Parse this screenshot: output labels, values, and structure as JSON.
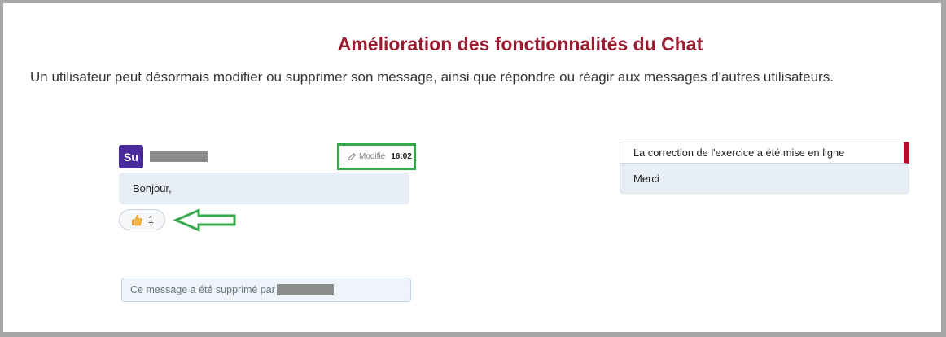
{
  "header": {
    "title": "Amélioration des fonctionnalités du Chat",
    "description": "Un utilisateur peut désormais modifier ou supprimer son message, ainsi que répondre ou réagir aux messages d'autres utilisateurs."
  },
  "edited_message": {
    "avatar_initials": "Su",
    "edited_label": "Modifié",
    "time": "16:02",
    "text": "Bonjour,",
    "reaction": {
      "icon": "thumbs-up-icon",
      "count": "1"
    }
  },
  "deleted_message": {
    "text": "Ce message a été supprimé par"
  },
  "reply_message": {
    "quoted_text": "La correction de l'exercice a été mise en ligne",
    "text": "Merci"
  },
  "icons": {
    "edit": "pencil-icon",
    "reaction": "thumbs-up-icon",
    "annotation_pointer": "arrow-left-icon"
  },
  "colors": {
    "title": "#9b1b30",
    "avatar": "#4b2a9b",
    "bubble": "#e8eef5",
    "annotation": "#35a84b",
    "quote_accent": "#b3102b",
    "redaction": "#8c8c8c"
  }
}
